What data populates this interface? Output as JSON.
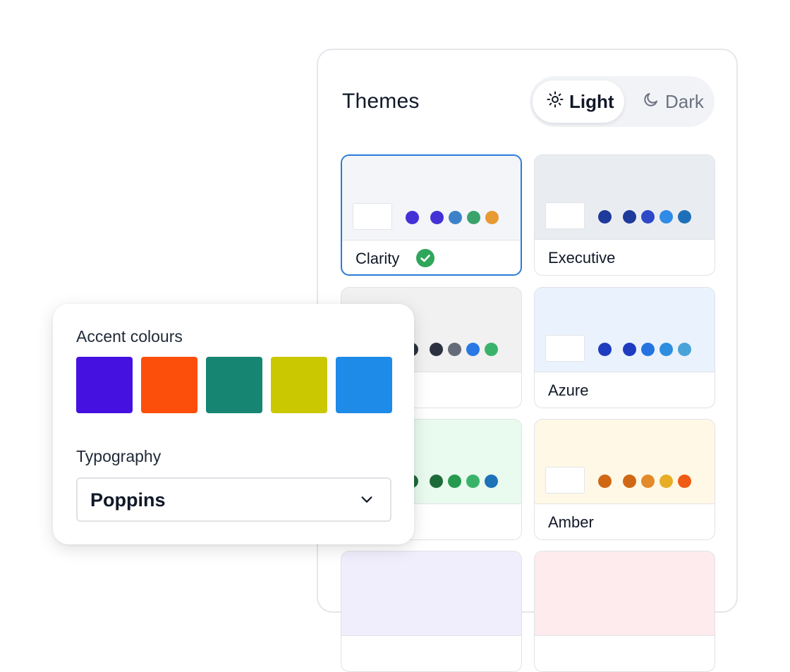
{
  "themes": {
    "title": "Themes",
    "mode": {
      "light_label": "Light",
      "dark_label": "Dark",
      "selected": "Light",
      "light_icon": "sun-icon",
      "dark_icon": "moon-icon"
    },
    "cards": [
      {
        "name": "Clarity",
        "selected": true,
        "bg": "#f3f5f9",
        "dots": [
          "#4431d6",
          "#4431d6",
          "#3d82c9",
          "#3aa36b",
          "#e79a32"
        ]
      },
      {
        "name": "Executive",
        "selected": false,
        "bg": "#e9edf2",
        "dots": [
          "#1e3a9a",
          "#1e3a9a",
          "#2d49c7",
          "#2f8be6",
          "#1d70b8"
        ]
      },
      {
        "name": "",
        "selected": false,
        "bg": "#f1f1f1",
        "dots": [
          "#2b3140",
          "#2b3140",
          "#646b78",
          "#2a78e4",
          "#3ab36a"
        ]
      },
      {
        "name": "Azure",
        "selected": false,
        "bg": "#eaf2fd",
        "dots": [
          "#1e3cc0",
          "#1e3cc0",
          "#2473e0",
          "#2d8ee0",
          "#4aa3d6"
        ]
      },
      {
        "name": "",
        "selected": false,
        "bg": "#e9faef",
        "dots": [
          "#1e6b3a",
          "#1e6b3a",
          "#259a4e",
          "#3ab36a",
          "#1d72b8"
        ]
      },
      {
        "name": "Amber",
        "selected": false,
        "bg": "#fff8e6",
        "dots": [
          "#d06714",
          "#d06714",
          "#e38a2a",
          "#e7ad25",
          "#f15a12"
        ]
      },
      {
        "name": "",
        "selected": false,
        "bg": "#f0eefc",
        "dots": []
      },
      {
        "name": "",
        "selected": false,
        "bg": "#fdebee",
        "dots": []
      }
    ]
  },
  "settings": {
    "accent_label": "Accent colours",
    "accent_colors": [
      "#4411e0",
      "#fc4f0b",
      "#168572",
      "#cac800",
      "#1e8be8"
    ],
    "typography_label": "Typography",
    "font_value": "Poppins",
    "dropdown_icon": "chevron-down-icon"
  }
}
